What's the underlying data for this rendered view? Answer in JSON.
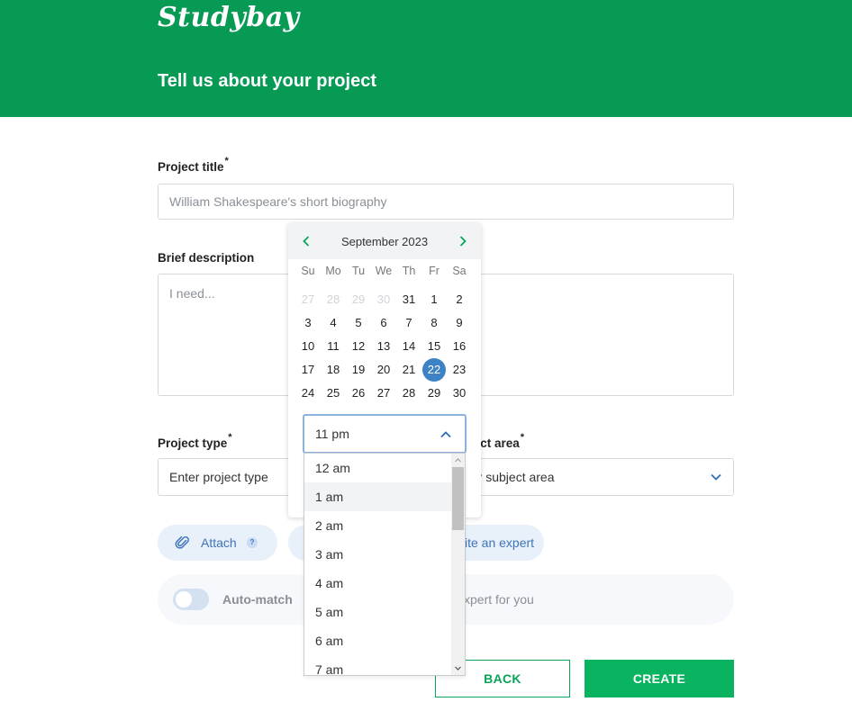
{
  "header": {
    "logo": "Studybay",
    "title": "Tell us about your project"
  },
  "form": {
    "project_title": {
      "label": "Project title",
      "required_mark": "*",
      "placeholder": "William Shakespeare's short biography"
    },
    "brief_description": {
      "label": "Brief description",
      "placeholder": "I need..."
    },
    "project_type": {
      "label": "Project type",
      "required_mark": "*",
      "placeholder": "Enter project type"
    },
    "subject_area": {
      "label": "ject area",
      "required_mark": "*",
      "placeholder": "ter subject area"
    },
    "attach": {
      "label": "Attach",
      "help": "?"
    },
    "invite": {
      "label": "ite an expert"
    },
    "automatch": {
      "label": "Auto-match",
      "description": "xpert for you",
      "enabled": false
    },
    "back_label": "BACK",
    "create_label": "CREATE"
  },
  "datepicker": {
    "month": "September 2023",
    "weekdays": [
      "Su",
      "Mo",
      "Tu",
      "We",
      "Th",
      "Fr",
      "Sa"
    ],
    "days": [
      {
        "d": "27",
        "muted": true
      },
      {
        "d": "28",
        "muted": true
      },
      {
        "d": "29",
        "muted": true
      },
      {
        "d": "30",
        "muted": true
      },
      {
        "d": "31",
        "muted": false
      },
      {
        "d": "1",
        "muted": false
      },
      {
        "d": "2",
        "muted": false
      },
      {
        "d": "3",
        "muted": false
      },
      {
        "d": "4",
        "muted": false
      },
      {
        "d": "5",
        "muted": false
      },
      {
        "d": "6",
        "muted": false
      },
      {
        "d": "7",
        "muted": false
      },
      {
        "d": "8",
        "muted": false
      },
      {
        "d": "9",
        "muted": false
      },
      {
        "d": "10",
        "muted": false
      },
      {
        "d": "11",
        "muted": false
      },
      {
        "d": "12",
        "muted": false
      },
      {
        "d": "13",
        "muted": false
      },
      {
        "d": "14",
        "muted": false
      },
      {
        "d": "15",
        "muted": false
      },
      {
        "d": "16",
        "muted": false
      },
      {
        "d": "17",
        "muted": false
      },
      {
        "d": "18",
        "muted": false
      },
      {
        "d": "19",
        "muted": false
      },
      {
        "d": "20",
        "muted": false
      },
      {
        "d": "21",
        "muted": false
      },
      {
        "d": "22",
        "muted": false,
        "selected": true
      },
      {
        "d": "23",
        "muted": false
      },
      {
        "d": "24",
        "muted": false
      },
      {
        "d": "25",
        "muted": false
      },
      {
        "d": "26",
        "muted": false
      },
      {
        "d": "27",
        "muted": false
      },
      {
        "d": "28",
        "muted": false
      },
      {
        "d": "29",
        "muted": false
      },
      {
        "d": "30",
        "muted": false
      }
    ],
    "time": {
      "value": "11 pm",
      "options": [
        "12 am",
        "1 am",
        "2 am",
        "3 am",
        "4 am",
        "5 am",
        "6 am",
        "7 am"
      ],
      "hovered_index": 1
    }
  },
  "colors": {
    "brand_green": "#079a55",
    "button_green": "#09b35f",
    "selected_day": "#3d82c4",
    "pill_blue": "#3f74b8"
  }
}
